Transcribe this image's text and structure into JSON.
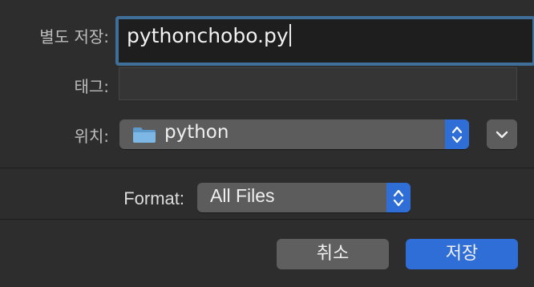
{
  "form": {
    "save_as_label": "별도 저장:",
    "save_as_value": "pythonchobo.py",
    "tags_label": "태그:",
    "tags_value": "",
    "where_label": "위치:",
    "where_value": "python",
    "format_label": "Format:",
    "format_value": "All Files"
  },
  "buttons": {
    "cancel_label": "취소",
    "save_label": "저장"
  },
  "icons": {
    "folder": "folder-icon",
    "stepper": "updown-stepper-icon",
    "expand": "chevron-down-icon"
  },
  "colors": {
    "accent": "#2f6ed6",
    "focus_ring": "#3f6f99",
    "folder": "#6aa7d8"
  }
}
